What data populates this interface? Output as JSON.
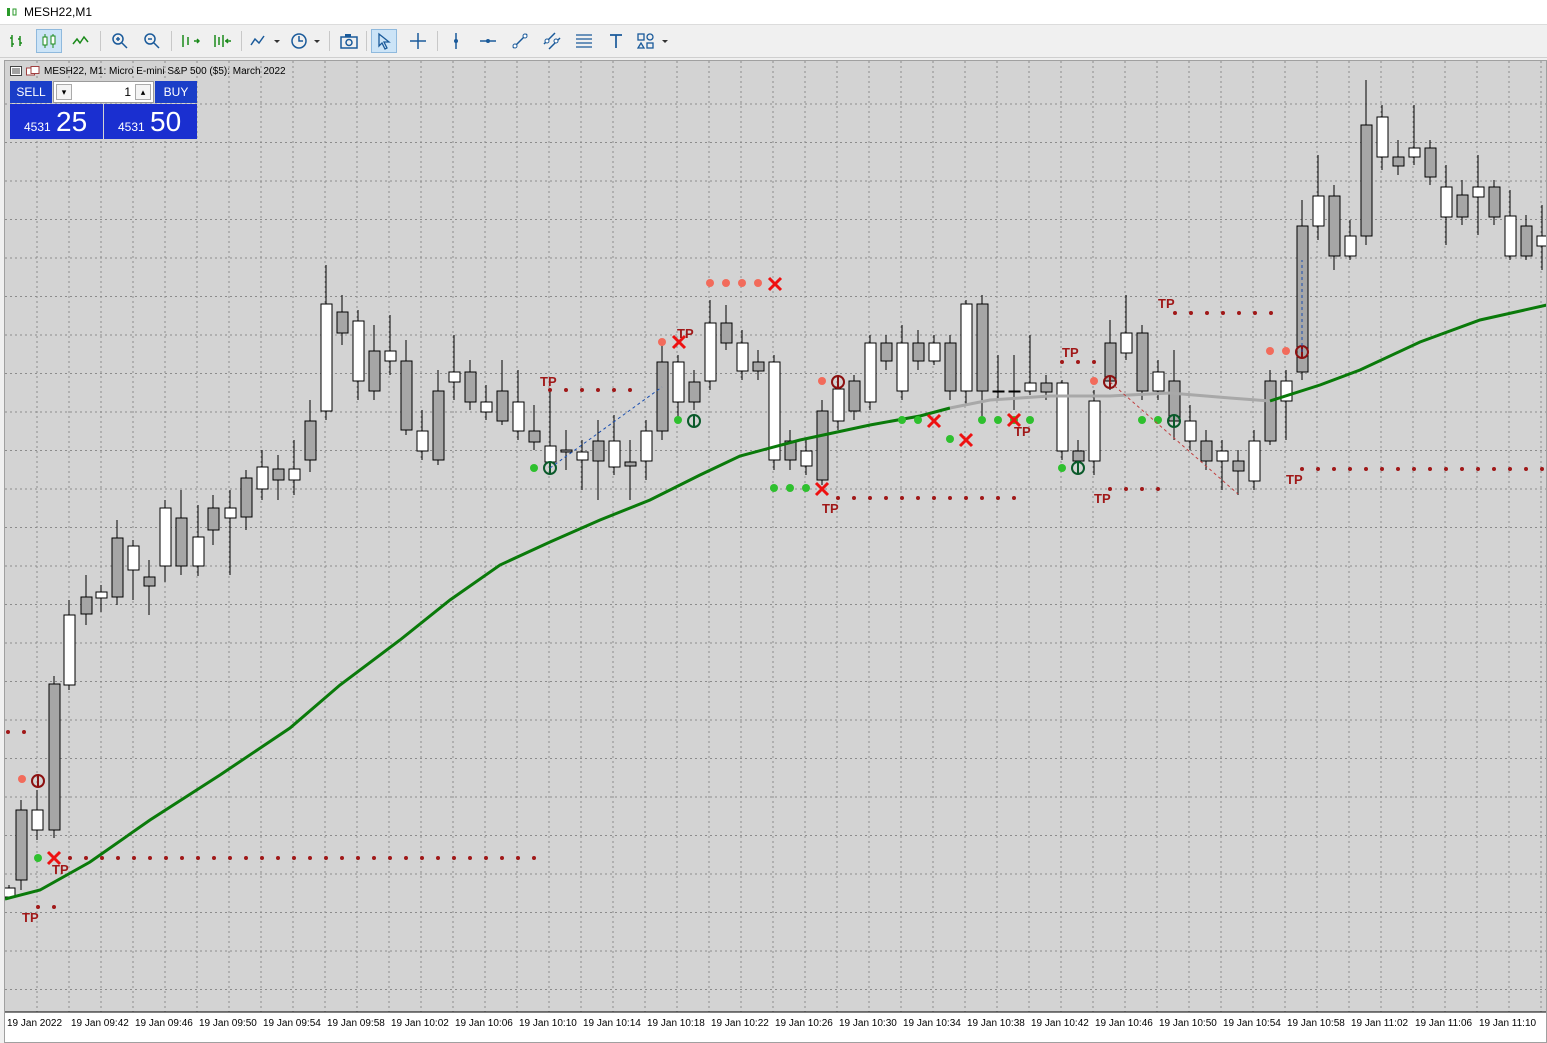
{
  "window": {
    "title": "MESH22,M1"
  },
  "toolbar": {
    "items": [
      "period-bars-icon",
      "candles-icon",
      "line-chart-icon",
      "zoom-in-icon",
      "zoom-out-icon",
      "autoscroll-icon",
      "chart-shift-icon",
      "indicators-icon",
      "periods-icon",
      "screenshot-icon",
      "cursor-icon",
      "crosshair-icon",
      "vertical-line-icon",
      "horizontal-line-icon",
      "trend-line-icon",
      "channel-icon",
      "fibonacci-icon",
      "text-icon",
      "shapes-icon"
    ]
  },
  "chart": {
    "header": "MESH22, M1:  Micro E-mini S&P 500 ($5): March 2022",
    "tp_label": "TP",
    "colors": {
      "background": "#d3d3d3",
      "grid": "#8c8c8c",
      "bull_candle": "#ffffff",
      "bear_candle": "#a6a6a6",
      "ma_line": "#0a7a0a",
      "ma_flat": "#a8a8a8",
      "dot_red": "#a01818",
      "dot_salmon": "#f26b5b",
      "dot_green": "#2ec02e",
      "cross": "#ee1111"
    },
    "x_labels": [
      "19 Jan 2022",
      "19 Jan 09:42",
      "19 Jan 09:46",
      "19 Jan 09:50",
      "19 Jan 09:54",
      "19 Jan 09:58",
      "19 Jan 10:02",
      "19 Jan 10:06",
      "19 Jan 10:10",
      "19 Jan 10:14",
      "19 Jan 10:18",
      "19 Jan 10:22",
      "19 Jan 10:26",
      "19 Jan 10:30",
      "19 Jan 10:34",
      "19 Jan 10:38",
      "19 Jan 10:42",
      "19 Jan 10:46",
      "19 Jan 10:50",
      "19 Jan 10:54",
      "19 Jan 10:58",
      "19 Jan 11:02",
      "19 Jan 11:06",
      "19 Jan 11:10"
    ]
  },
  "trade": {
    "sell_label": "SELL",
    "buy_label": "BUY",
    "lot": "1",
    "bid_prefix": "4531",
    "bid_big": "25",
    "ask_prefix": "4531",
    "ask_big": "50"
  }
}
